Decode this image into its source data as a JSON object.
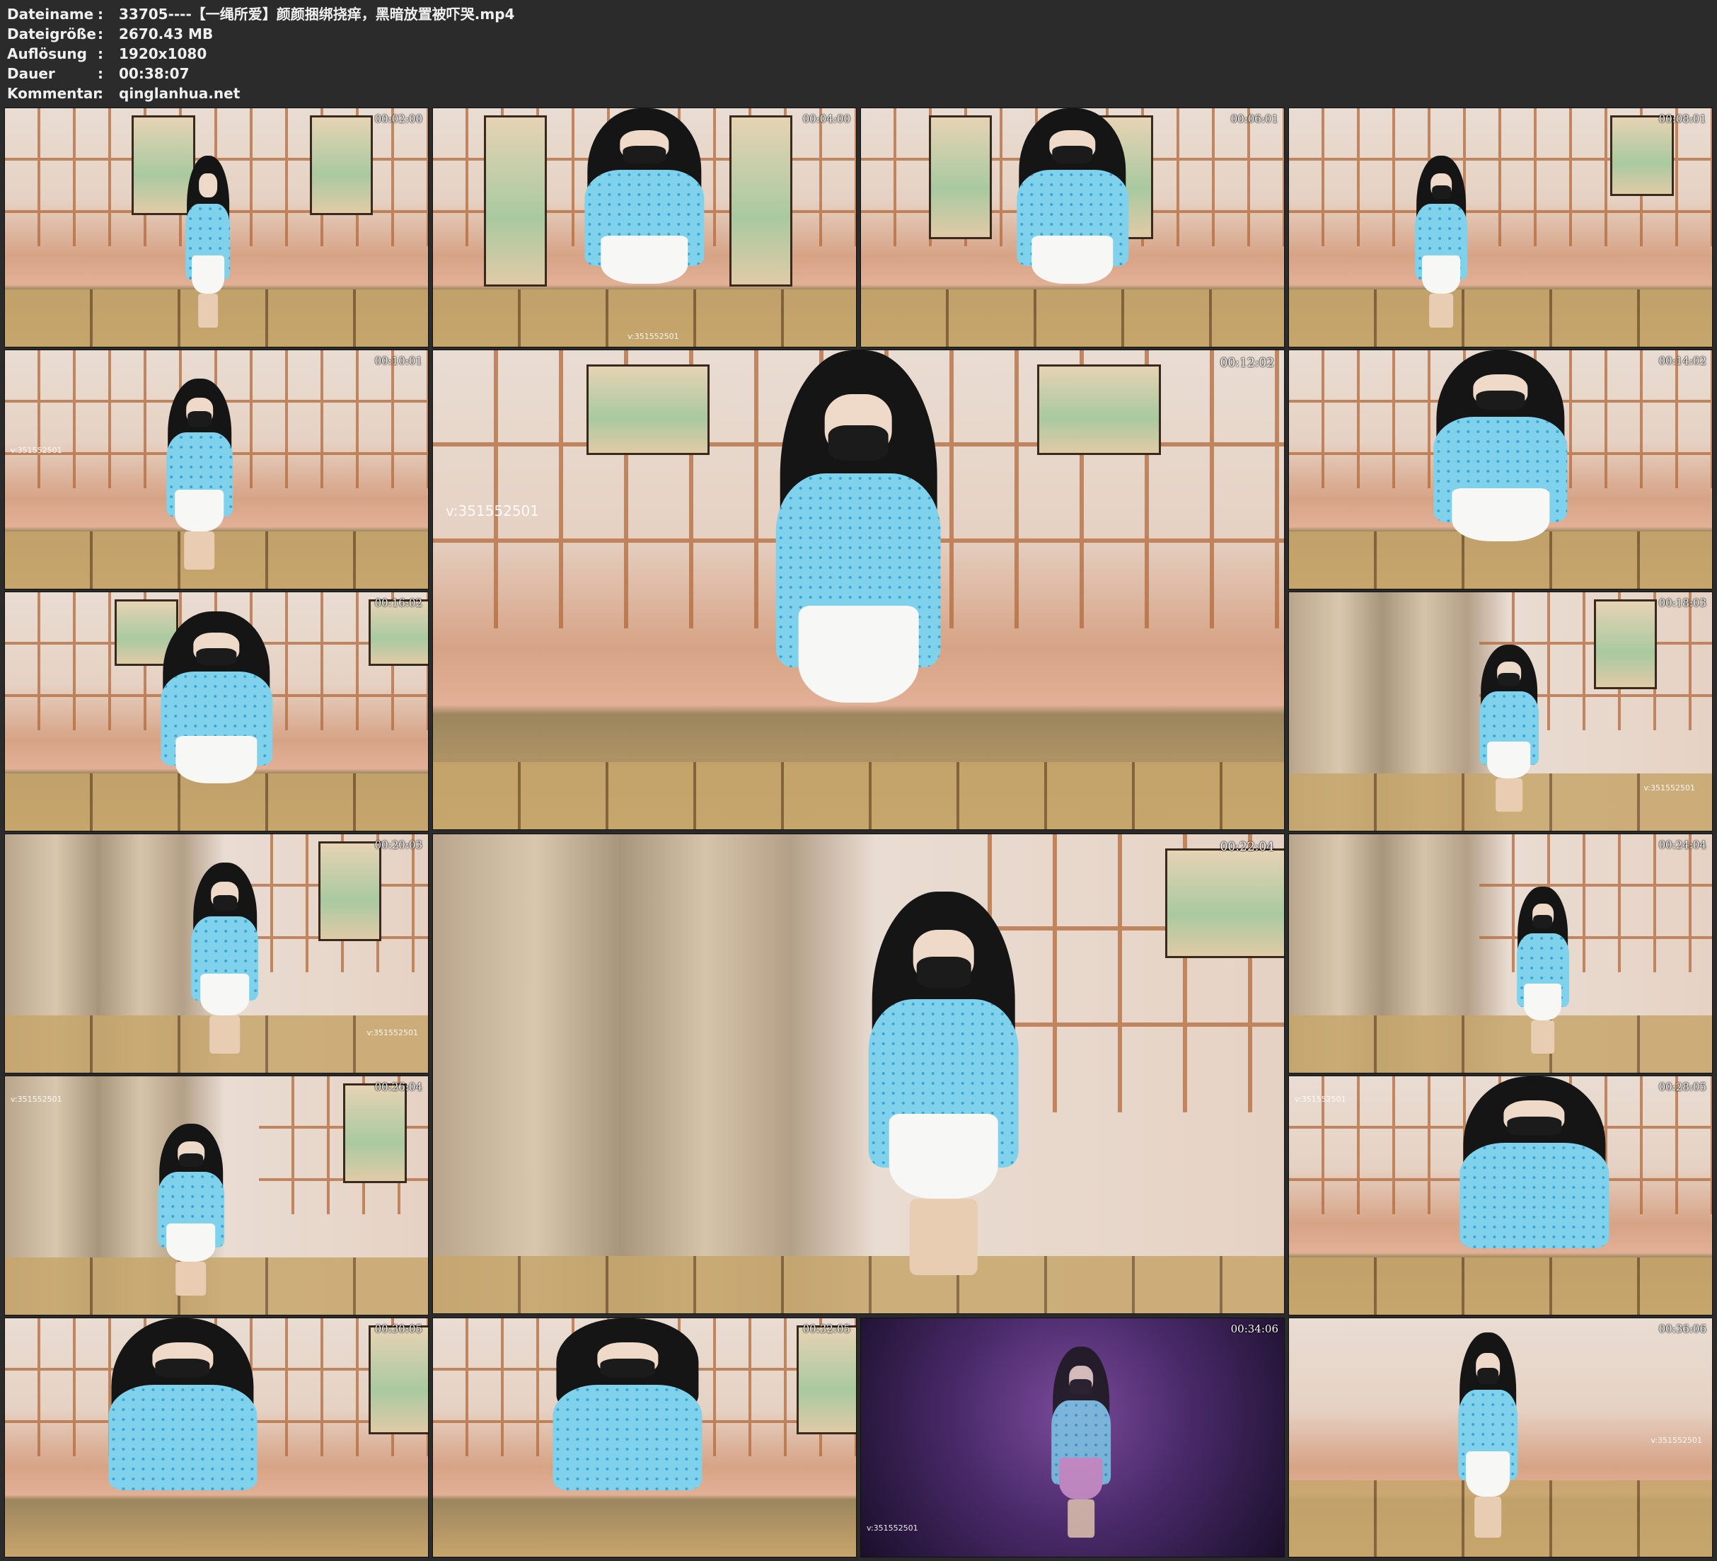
{
  "info": {
    "rows": [
      {
        "key": "Dateiname",
        "value": "33705----【一绳所爱】颜颜捆绑挠痒，黑暗放置被吓哭.mp4"
      },
      {
        "key": "Dateigröße",
        "value": "2670.43 MB"
      },
      {
        "key": "Auflösung",
        "value": "1920x1080"
      },
      {
        "key": "Dauer",
        "value": "00:38:07"
      },
      {
        "key": "Kommentar",
        "value": "qinglanhua.net"
      }
    ],
    "separator": ":"
  },
  "watermark": "v:351552501",
  "thumbnails": [
    {
      "time": "00:02:00"
    },
    {
      "time": "00:04:00"
    },
    {
      "time": "00:06:01"
    },
    {
      "time": "00:08:01"
    },
    {
      "time": "00:10:01"
    },
    {
      "time": "00:12:02"
    },
    {
      "time": "00:14:02"
    },
    {
      "time": "00:16:02"
    },
    {
      "time": "00:18:03"
    },
    {
      "time": "00:20:03"
    },
    {
      "time": "00:22:04"
    },
    {
      "time": "00:24:04"
    },
    {
      "time": "00:26:04"
    },
    {
      "time": "00:28:05"
    },
    {
      "time": "00:30:05"
    },
    {
      "time": "00:32:05"
    },
    {
      "time": "00:34:06"
    },
    {
      "time": "00:36:06"
    }
  ]
}
